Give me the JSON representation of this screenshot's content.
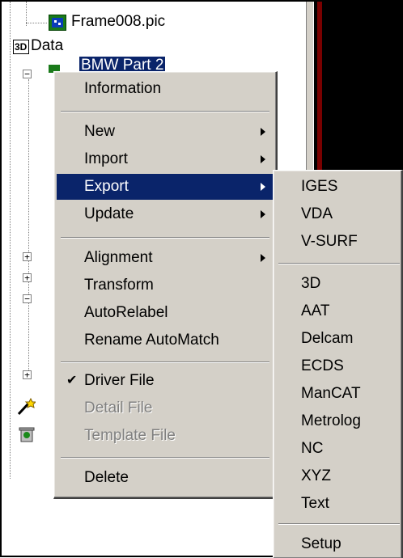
{
  "tree": {
    "frame_file": "Frame008.pic",
    "data_node": "Data",
    "selected_node": "BMW Part 2",
    "node_3d_badge": "3D"
  },
  "context_menu": {
    "information": "Information",
    "new": "New",
    "import": "Import",
    "export": "Export",
    "update": "Update",
    "alignment": "Alignment",
    "transform": "Transform",
    "auto_relabel": "AutoRelabel",
    "rename_automatch": "Rename AutoMatch",
    "driver_file": "Driver File",
    "driver_file_checked": true,
    "detail_file": "Detail File",
    "template_file": "Template File",
    "delete": "Delete"
  },
  "export_submenu": {
    "items_group1": [
      "IGES",
      "VDA",
      "V-SURF"
    ],
    "items_group2": [
      "3D",
      "AAT",
      "Delcam",
      "ECDS",
      "ManCAT",
      "Metrolog",
      "NC",
      "XYZ",
      "Text"
    ],
    "setup": "Setup"
  },
  "colors": {
    "menu_bg": "#d4d0c8",
    "highlight": "#0a246a",
    "disabled_text": "#808080",
    "dark_pane": "#000000",
    "dark_pane_edge": "#7a0000"
  }
}
